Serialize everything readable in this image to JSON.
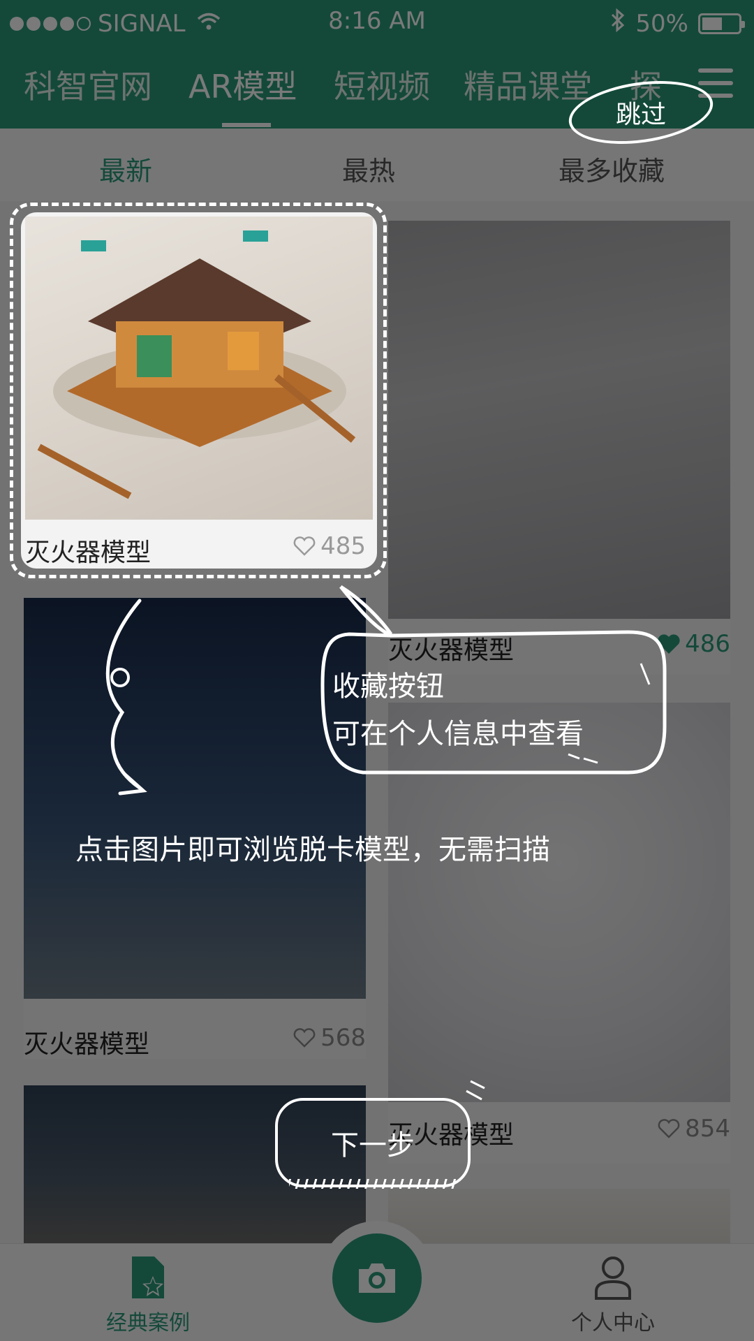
{
  "status_bar": {
    "carrier": "SIGNAL",
    "time": "8:16 AM",
    "battery_percent": "50%",
    "battery_level": 0.5
  },
  "top_nav": {
    "tabs": [
      "科智官网",
      "AR模型",
      "短视频",
      "精品课堂",
      "探"
    ],
    "active_tab": "AR模型"
  },
  "sub_tabs": {
    "items": [
      "最新",
      "最热",
      "最多收藏"
    ],
    "active": "最新"
  },
  "cards": [
    {
      "title": "灭火器模型",
      "likes": "485",
      "liked": false
    },
    {
      "title": "灭火器模型",
      "likes": "486",
      "liked": true
    },
    {
      "title": "灭火器模型",
      "likes": "568",
      "liked": false
    },
    {
      "title": "灭火器模型",
      "likes": "854",
      "liked": false
    }
  ],
  "guide": {
    "skip_label": "跳过",
    "favorite_tip_line1": "收藏按钮",
    "favorite_tip_line2": "可在个人信息中查看",
    "browse_tip": "点击图片即可浏览脱卡模型，无需扫描",
    "next_label": "下一步"
  },
  "bottom_bar": {
    "left_label": "经典案例",
    "right_label": "个人中心"
  },
  "colors": {
    "brand": "#2b9a78",
    "overlay": "rgba(0,0,0,0.52)"
  },
  "icons": [
    "wifi-icon",
    "bluetooth-icon",
    "battery-icon",
    "menu-icon",
    "heart-icon",
    "star-document-icon",
    "camera-icon",
    "person-icon"
  ]
}
